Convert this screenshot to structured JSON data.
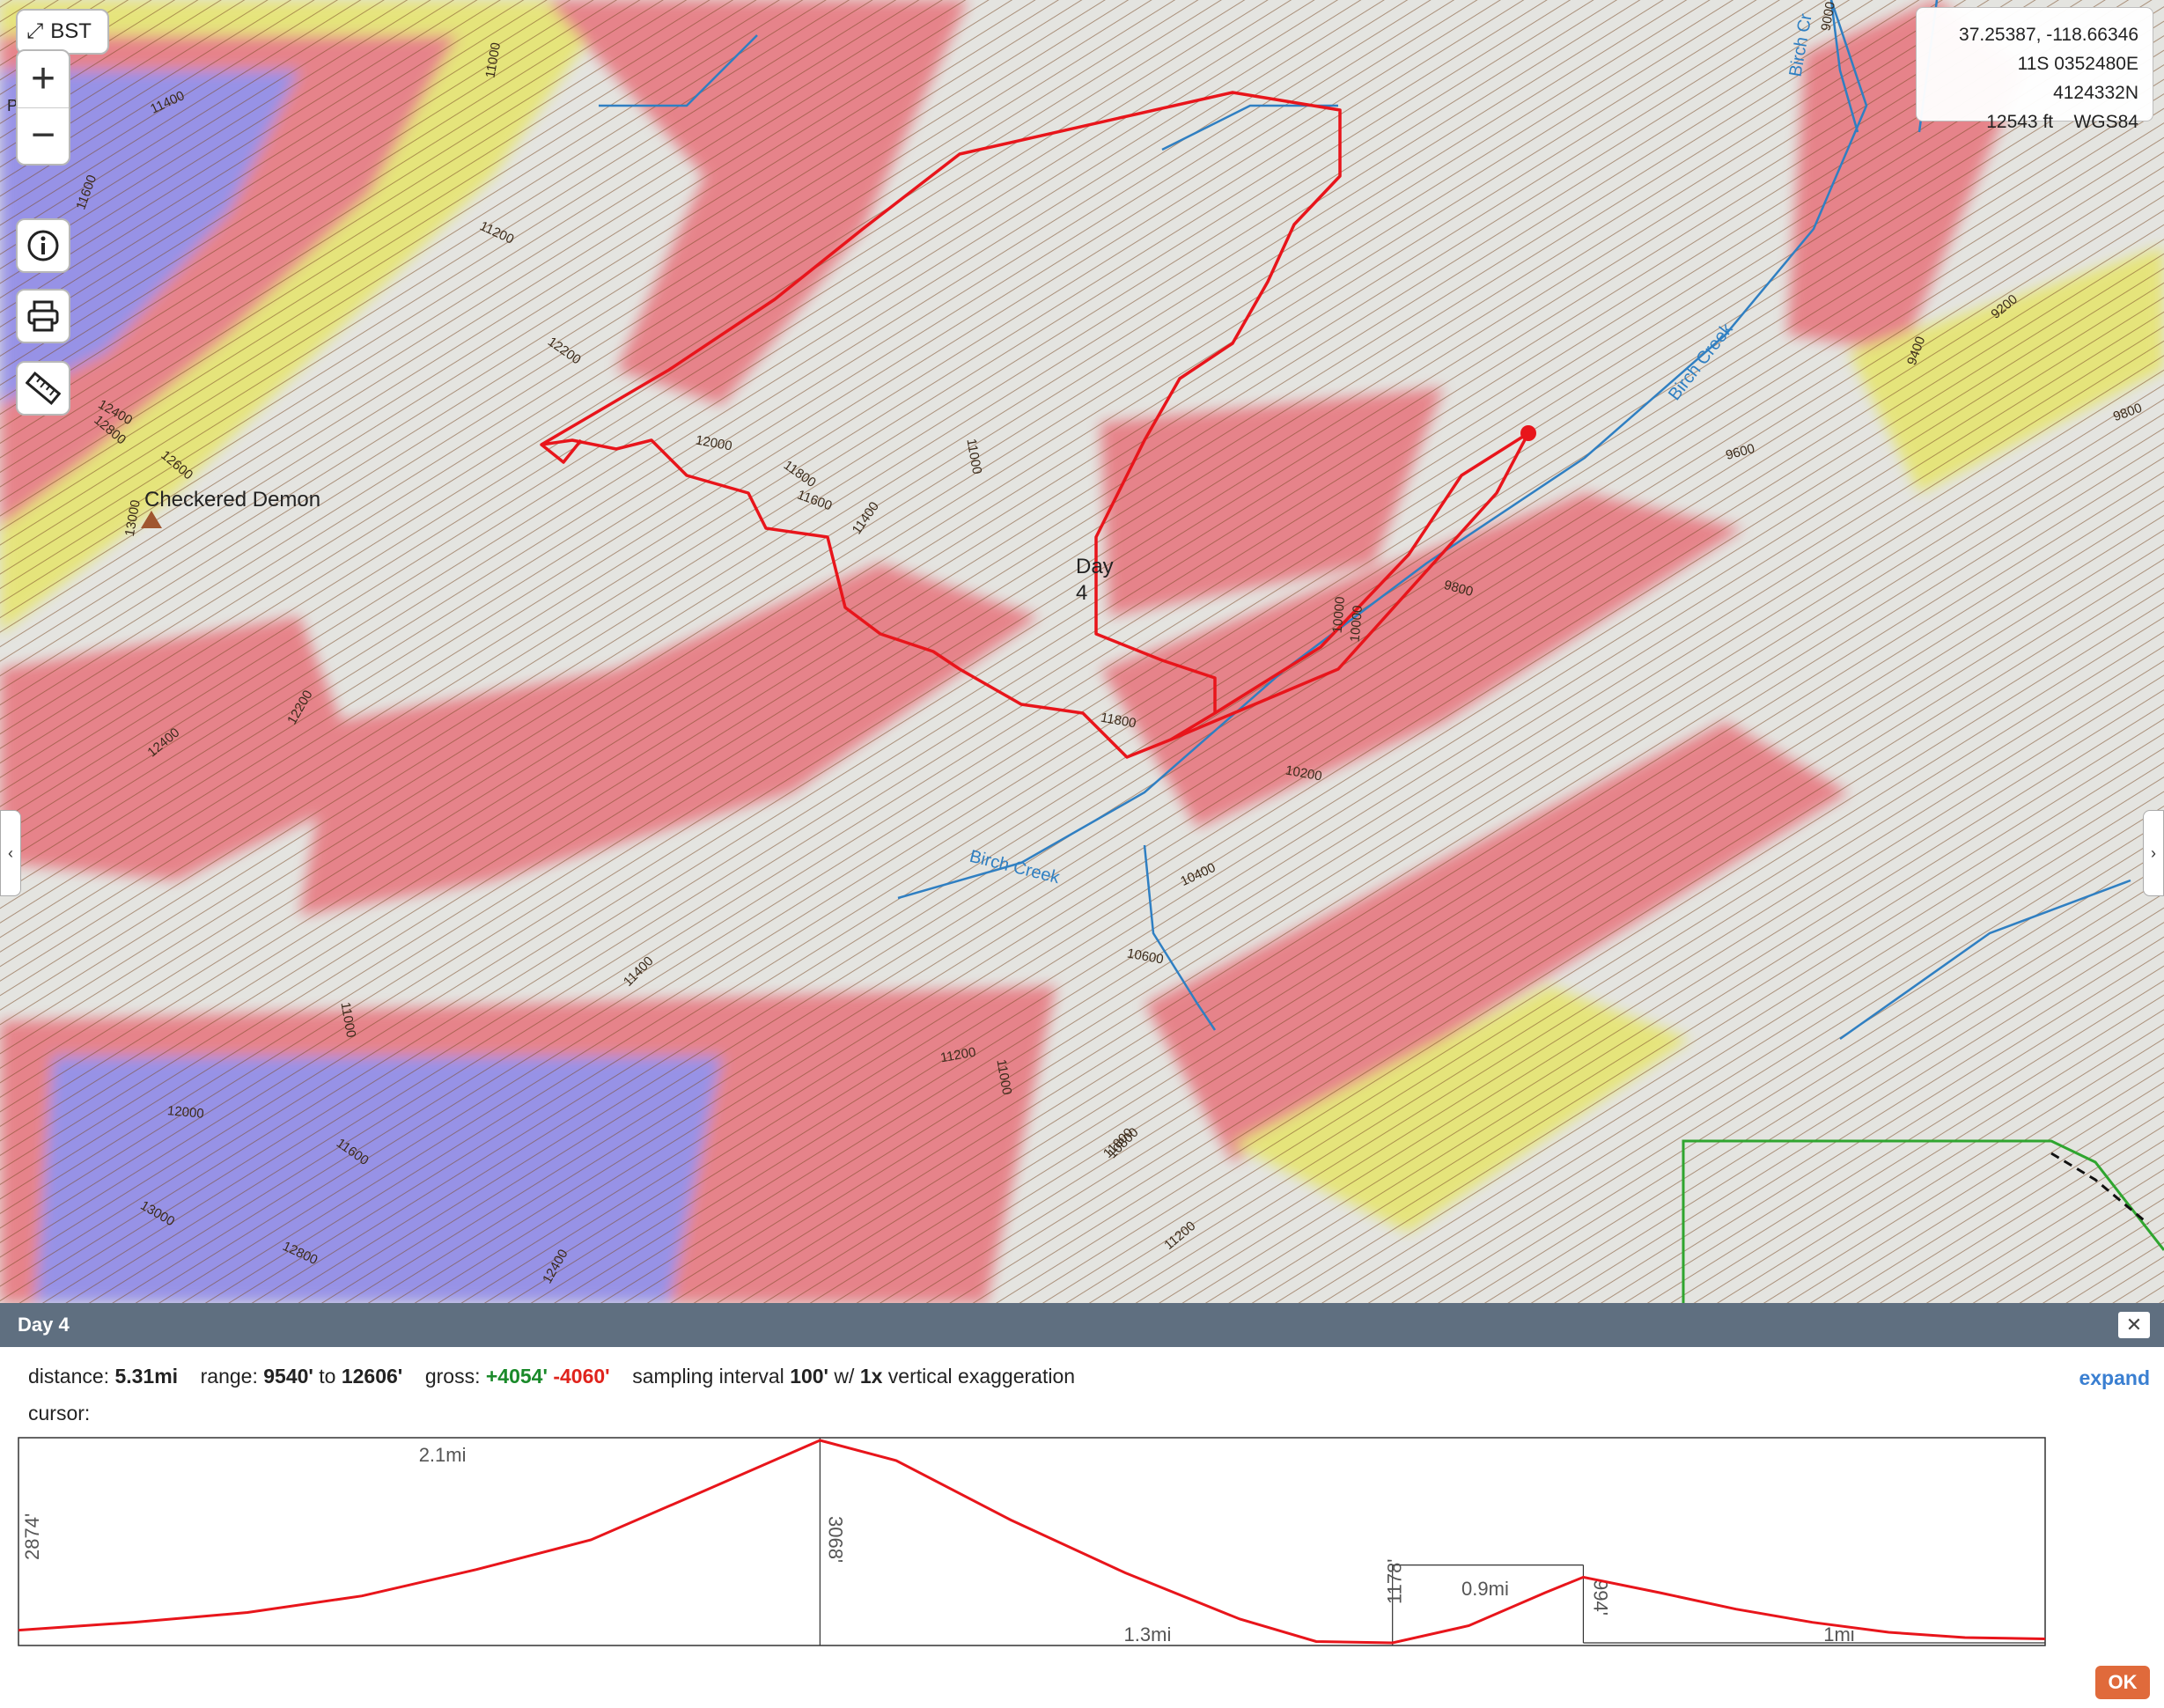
{
  "map": {
    "bst_label": "BST",
    "zoom_in": "+",
    "zoom_out": "−",
    "info_icon": "info-icon",
    "print_icon": "print-icon",
    "measure_icon": "ruler-icon",
    "coords": {
      "latlon": "37.25387, -118.66346",
      "utm": "11S 0352480E 4124332N",
      "elevation": "12543 ft",
      "datum": "WGS84"
    },
    "left_tab": "‹",
    "right_tab": "›",
    "labels": {
      "peak_name": "Checkered Demon",
      "peak_partial": "Pe..",
      "day_label_line1": "Day",
      "day_label_line2": "4",
      "creek1": "Birch Creek",
      "creek2": "Birch Creek",
      "creek3": "Birch Cr"
    },
    "contour_labels": [
      "11400",
      "11000",
      "11600",
      "11200",
      "12200",
      "12400",
      "12800",
      "12600",
      "13000",
      "12000",
      "11800",
      "11600",
      "11400",
      "11000",
      "12200",
      "12400",
      "11800",
      "11400",
      "11000",
      "11200",
      "11000",
      "12000",
      "11800",
      "12800",
      "13000",
      "12400",
      "11600",
      "10200",
      "10400",
      "10600",
      "10800",
      "11200",
      "9800",
      "10000",
      "9600",
      "9400",
      "9200",
      "9000",
      "9800",
      "10000"
    ],
    "colors": {
      "route": "#e8151b",
      "creek": "#2f7fc2",
      "contour": "#7a4a25",
      "slope_red": "#e7737b",
      "slope_yellow": "#e6e46a",
      "slope_blue": "#8a84e8",
      "boundary": "#2fa52f"
    }
  },
  "panel": {
    "title": "Day 4",
    "close": "✕",
    "stats": {
      "distance_label": "distance:",
      "distance_value": "5.31mi",
      "range_label": "range:",
      "range_low": "9540'",
      "range_to": "to",
      "range_high": "12606'",
      "gross_label": "gross:",
      "gain": "+4054'",
      "loss": "-4060'",
      "sampling_prefix": "sampling interval",
      "interval": "100'",
      "w_text": "w/",
      "exaggeration": "1x",
      "exaggeration_suffix": "vertical exaggeration"
    },
    "cursor_label": "cursor:",
    "expand": "expand",
    "ok": "OK",
    "profile_annotations": {
      "seg1_gain": "2874'",
      "seg1_dist": "2.1mi",
      "seg2_loss": "3068'",
      "seg2_dist": "1.3mi",
      "seg3_gain": "1178'",
      "seg3_dist": "0.9mi",
      "seg4_loss": "994'",
      "seg4_dist": "1mi"
    }
  },
  "chart_data": {
    "type": "line",
    "xlabel": "",
    "ylabel": "",
    "xlim": [
      0,
      5.31
    ],
    "ylim": [
      9540,
      12606
    ],
    "series": [
      {
        "x": [
          0,
          0.3,
          0.6,
          0.9,
          1.2,
          1.5,
          1.8,
          2.1,
          2.3,
          2.6,
          2.9,
          3.2,
          3.4,
          3.6,
          3.8,
          4.0,
          4.1,
          4.3,
          4.5,
          4.7,
          4.9,
          5.1,
          5.31
        ],
        "y": [
          9732,
          9850,
          10000,
          10250,
          10650,
          11100,
          11850,
          12606,
          12300,
          11400,
          10600,
          9900,
          9560,
          9540,
          9800,
          10300,
          10534,
          10300,
          10050,
          9850,
          9700,
          9620,
          9600
        ]
      }
    ]
  }
}
